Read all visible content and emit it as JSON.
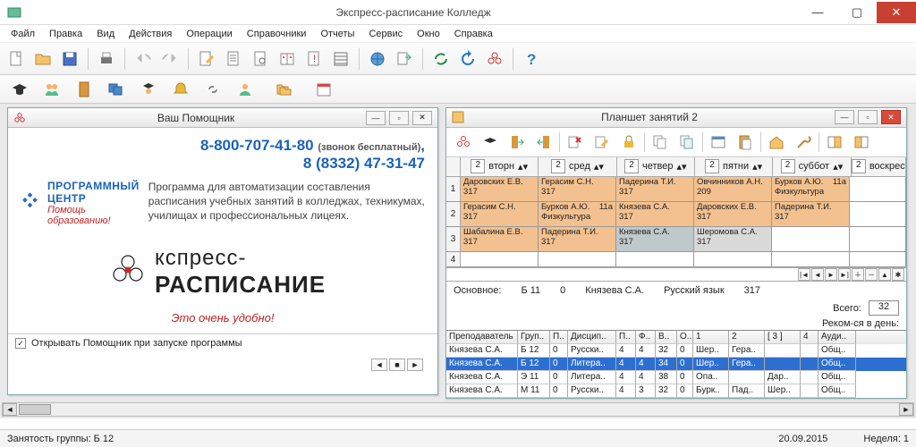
{
  "window": {
    "title": "Экспресс-расписание Колледж"
  },
  "menu": [
    "Файл",
    "Правка",
    "Вид",
    "Действия",
    "Операции",
    "Справочники",
    "Отчеты",
    "Сервис",
    "Окно",
    "Справка"
  ],
  "helper": {
    "title": "Ваш Помощник",
    "phone1": "8-800-707-41-80",
    "phone1_note": "(звонок бесплатный)",
    "phone2": "8 (8332) 47-31-47",
    "logo_title": "ПРОГРАММНЫЙ ЦЕНТР",
    "logo_sub": "Помощь образованию!",
    "desc": "Программа для автоматизации составления расписания учебных занятий в колледжах, техникумах, училищах и профессиональных лицеях.",
    "logo2_line1": "кспресс-",
    "logo2_line2": "РАСПИСАНИЕ",
    "slogan": "Это очень удобно!",
    "open_on_start": "Открывать Помощник при запуске программы",
    "open_on_start_checked": "✓"
  },
  "planshet": {
    "title": "Планшет занятий 2",
    "days": [
      "вторн",
      "сред",
      "четвер",
      "пятни",
      "суббот",
      "воскрес"
    ],
    "day_num": "2",
    "rows": [
      [
        {
          "t": "Даровских Е.В.",
          "r": "317",
          "c": "o"
        },
        {
          "t": "Герасим С.Н.",
          "r": "317",
          "c": "o"
        },
        {
          "t": "Падерина Т.И.",
          "r": "317",
          "c": "o"
        },
        {
          "t": "Овчинников А.Н.",
          "r": "209",
          "c": "o"
        },
        {
          "t": "Бурков А.Ю.",
          "r": "Физкультура",
          "ext": "11а",
          "c": "o"
        }
      ],
      [
        {
          "t": "Герасим С.Н.",
          "r": "317",
          "c": "o"
        },
        {
          "t": "Бурков А.Ю.",
          "r": "Физкультура",
          "ext": "11а",
          "c": "o"
        },
        {
          "t": "Князева С.А.",
          "r": "317",
          "c": "o"
        },
        {
          "t": "Даровских Е.В.",
          "r": "317",
          "c": "o"
        },
        {
          "t": "Падерина Т.И.",
          "r": "317",
          "c": "o"
        }
      ],
      [
        {
          "t": "Шабалина Е.В.",
          "r": "317",
          "c": "o"
        },
        {
          "t": "Падерина Т.И.",
          "r": "317",
          "c": "o"
        },
        {
          "t": "Князева С.А.",
          "r": "317",
          "c": "sel"
        },
        {
          "t": "Шеромова С.А.",
          "r": "317",
          "c": "g"
        },
        {
          "t": "",
          "r": "",
          "c": ""
        }
      ]
    ],
    "info": {
      "osn": "Основное:",
      "grp": "Б 11",
      "zero": "0",
      "teacher": "Князева С.А.",
      "subj": "Русский язык",
      "room": "317"
    },
    "total_label": "Всего:",
    "total": "32",
    "rec_label": "Реком-ся в день:",
    "columns": [
      "Преподаватель",
      "Груп..",
      "П..",
      "Дисцип..",
      "П..",
      "Ф..",
      "В..",
      "О..",
      "1",
      "2",
      "[ 3 ]",
      "4",
      "Ауди.."
    ],
    "trs": [
      {
        "sel": false,
        "c": [
          "Князева С.А.",
          "Б 12",
          "0",
          "Русски..",
          "4",
          "4",
          "32",
          "0",
          "Шер..",
          "Гера..",
          "",
          "",
          "Общ.."
        ]
      },
      {
        "sel": true,
        "c": [
          "Князева С.А.",
          "Б 12",
          "0",
          "Литера..",
          "4",
          "4",
          "34",
          "0",
          "Шер..",
          "Гера..",
          "",
          "",
          "Общ.."
        ]
      },
      {
        "sel": false,
        "c": [
          "Князева С.А.",
          "Э 11",
          "0",
          "Литера..",
          "4",
          "4",
          "38",
          "0",
          "Опа..",
          "",
          "Дар..",
          "",
          "Общ.."
        ]
      },
      {
        "sel": false,
        "c": [
          "Князева С.А.",
          "М 11",
          "0",
          "Русски..",
          "4",
          "3",
          "32",
          "0",
          "Бурк..",
          "Пад..",
          "Шер..",
          "",
          "Общ.."
        ]
      }
    ]
  },
  "status": {
    "left": "Занятость группы: Б 12",
    "date": "20.09.2015",
    "week": "Неделя:  1"
  }
}
